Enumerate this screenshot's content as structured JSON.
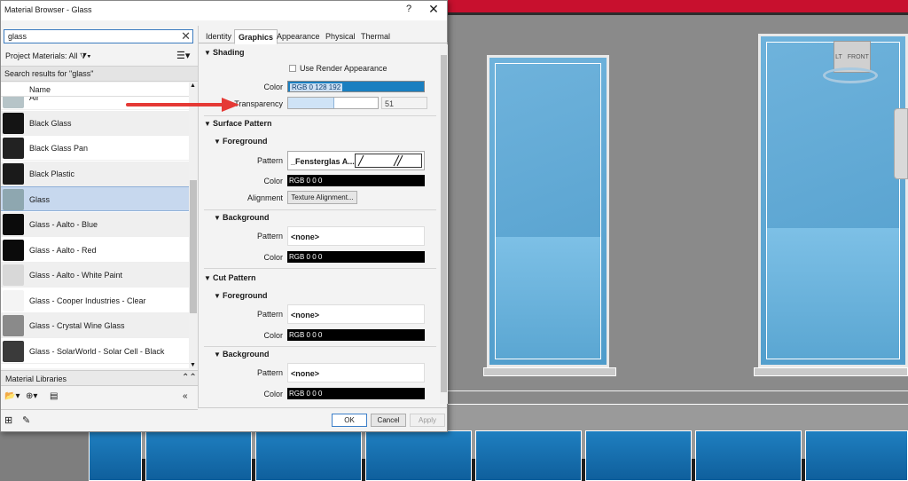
{
  "dialog": {
    "title": "Material Browser - Glass",
    "help": "?",
    "close": "✕"
  },
  "search": {
    "value": "glass"
  },
  "project_materials": {
    "label": "Project Materials: All",
    "filter_icon": "filter-icon",
    "view_icon": "list-view-icon"
  },
  "results_header": "Search results for \"glass\"",
  "list_header": "Name",
  "materials": [
    {
      "name": "Air",
      "thumb": "#b6c4c8"
    },
    {
      "name": "Black Glass",
      "thumb": "#141414"
    },
    {
      "name": "Black Glass Pan",
      "thumb": "#222222"
    },
    {
      "name": "Black Plastic",
      "thumb": "#1a1a1a"
    },
    {
      "name": "Glass",
      "thumb": "#8ea7b0",
      "selected": true
    },
    {
      "name": "Glass - Aalto - Blue",
      "thumb": "#0b0b0b"
    },
    {
      "name": "Glass - Aalto - Red",
      "thumb": "#0b0b0b"
    },
    {
      "name": "Glass - Aalto - White Paint",
      "thumb": "#d8d8d8"
    },
    {
      "name": "Glass - Cooper Industries - Clear",
      "thumb": "#f4f4f4"
    },
    {
      "name": "Glass - Crystal Wine Glass",
      "thumb": "#8a8a8a"
    },
    {
      "name": "Glass - SolarWorld - Solar Cell - Black",
      "thumb": "#3a3a3a"
    }
  ],
  "material_libraries": "Material Libraries",
  "tabs": [
    "Identity",
    "Graphics",
    "Appearance",
    "Physical",
    "Thermal"
  ],
  "active_tab": "Graphics",
  "graphics": {
    "shading": {
      "title": "Shading",
      "use_render": "Use Render Appearance",
      "color_label": "Color",
      "color_value": "RGB 0 128 192",
      "color_hex": "#1a7fc0",
      "transparency_label": "Transparency",
      "transparency_value": "51",
      "transparency_fraction": 0.51
    },
    "surface_pattern": {
      "title": "Surface Pattern",
      "foreground": {
        "title": "Foreground",
        "pattern_label": "Pattern",
        "pattern_value": "_Fensterglas A...",
        "color_label": "Color",
        "color_value": "RGB 0 0 0",
        "alignment_label": "Alignment",
        "alignment_button": "Texture Alignment..."
      },
      "background": {
        "title": "Background",
        "pattern_label": "Pattern",
        "pattern_value": "<none>",
        "color_label": "Color",
        "color_value": "RGB 0 0 0"
      }
    },
    "cut_pattern": {
      "title": "Cut Pattern",
      "foreground": {
        "title": "Foreground",
        "pattern_label": "Pattern",
        "pattern_value": "<none>",
        "color_label": "Color",
        "color_value": "RGB 0 0 0"
      },
      "background": {
        "title": "Background",
        "pattern_label": "Pattern",
        "pattern_value": "<none>",
        "color_label": "Color",
        "color_value": "RGB 0 0 0"
      }
    }
  },
  "buttons": {
    "ok": "OK",
    "cancel": "Cancel",
    "apply": "Apply"
  },
  "viewcube": {
    "left": "LT",
    "front": "FRONT"
  },
  "colors": {
    "accent": "#3c7fc9",
    "annotation_arrow": "#e53935",
    "roof": "#c8102e",
    "glass": "#4f9ccb"
  }
}
